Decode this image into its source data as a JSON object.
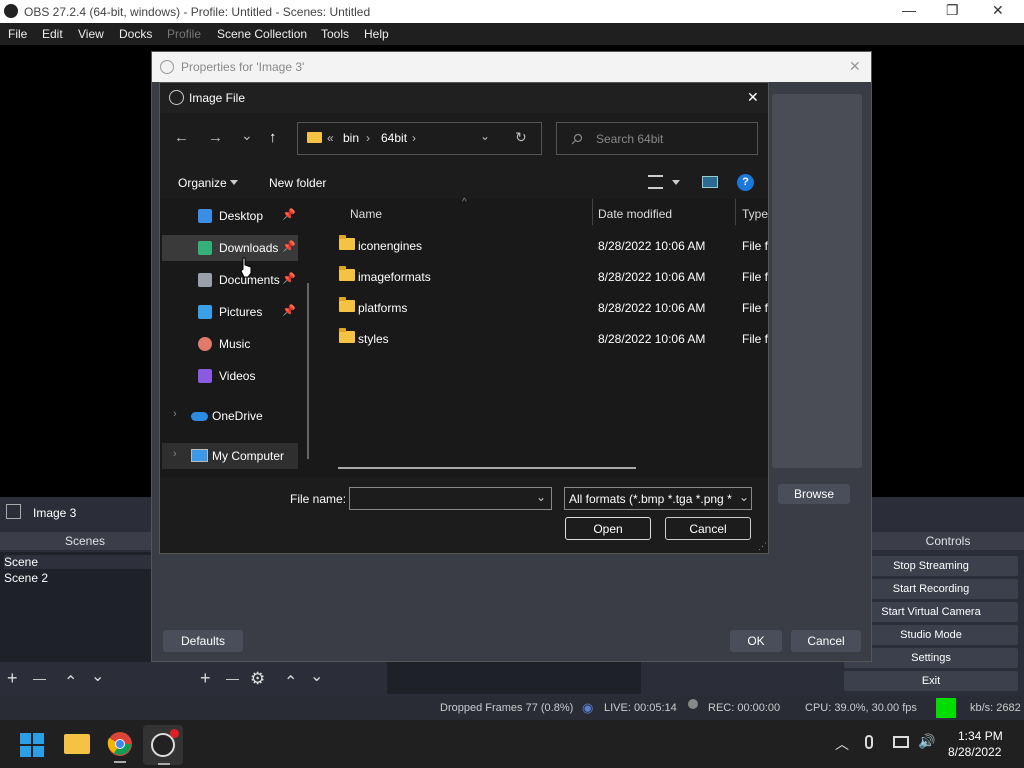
{
  "window": {
    "title": "OBS 27.2.4 (64-bit, windows) - Profile: Untitled - Scenes: Untitled",
    "minimize_glyph": "—",
    "maximize_glyph": "❐",
    "close_glyph": "✕"
  },
  "menu": {
    "file": "File",
    "edit": "Edit",
    "view": "View",
    "docks": "Docks",
    "profile": "Profile",
    "scene_collection": "Scene Collection",
    "tools": "Tools",
    "help": "Help"
  },
  "properties": {
    "title": "Properties for 'Image 3'",
    "browse": "Browse",
    "defaults": "Defaults",
    "ok": "OK",
    "cancel": "Cancel",
    "close_glyph": "✕"
  },
  "source_bar": {
    "name": "Image 3"
  },
  "scenes": {
    "header": "Scenes",
    "items": [
      "Scene",
      "Scene 2"
    ]
  },
  "controls": {
    "header": "Controls",
    "buttons": [
      "Stop Streaming",
      "Start Recording",
      "Start Virtual Camera",
      "Studio Mode",
      "Settings",
      "Exit"
    ]
  },
  "toolbar_glyphs": {
    "add": "+",
    "remove": "—",
    "up": "⌃",
    "down": "⌄",
    "gear": "⚙"
  },
  "status": {
    "dropped": "Dropped Frames 77 (0.8%)",
    "live": "LIVE: 00:05:14",
    "rec": "REC: 00:00:00",
    "cpu": "CPU: 39.0%, 30.00 fps",
    "kbs": "kb/s: 2682"
  },
  "file_dialog": {
    "title": "Image File",
    "close_glyph": "✕",
    "nav_glyphs": {
      "back": "←",
      "forward": "→",
      "recent": "⌄",
      "up": "↑",
      "refresh": "↻",
      "dropdown": "⌄"
    },
    "path": [
      "«",
      "bin",
      "›",
      "64bit",
      "›"
    ],
    "search_placeholder": "Search 64bit",
    "organize": "Organize",
    "new_folder": "New folder",
    "help_glyph": "?",
    "nav_items": [
      {
        "label": "Desktop",
        "icon": "desktop-icon",
        "color": "#3a8ee6"
      },
      {
        "label": "Downloads",
        "icon": "downloads-icon",
        "color": "#35b07a"
      },
      {
        "label": "Documents",
        "icon": "documents-icon",
        "color": "#9aa0aa"
      },
      {
        "label": "Pictures",
        "icon": "pictures-icon",
        "color": "#3aa0e8"
      },
      {
        "label": "Music",
        "icon": "music-icon",
        "color": "#e07a6a"
      },
      {
        "label": "Videos",
        "icon": "videos-icon",
        "color": "#8a5ae0"
      }
    ],
    "onedrive": "OneDrive",
    "my_computer": "My Computer",
    "columns": {
      "name": "Name",
      "date": "Date modified",
      "type": "Type"
    },
    "files": [
      {
        "name": "iconengines",
        "date": "8/28/2022 10:06 AM",
        "type": "File fo"
      },
      {
        "name": "imageformats",
        "date": "8/28/2022 10:06 AM",
        "type": "File fo"
      },
      {
        "name": "platforms",
        "date": "8/28/2022 10:06 AM",
        "type": "File fo"
      },
      {
        "name": "styles",
        "date": "8/28/2022 10:06 AM",
        "type": "File fo"
      }
    ],
    "filename_label": "File name:",
    "filename_value": "",
    "filter": "All formats (*.bmp *.tga *.png *",
    "open": "Open",
    "cancel": "Cancel"
  },
  "taskbar": {
    "time": "1:34 PM",
    "date": "8/28/2022"
  },
  "colors": {
    "accent": "#0078d4",
    "live_indicator": "#00dd00",
    "folder": "#f5c244"
  }
}
